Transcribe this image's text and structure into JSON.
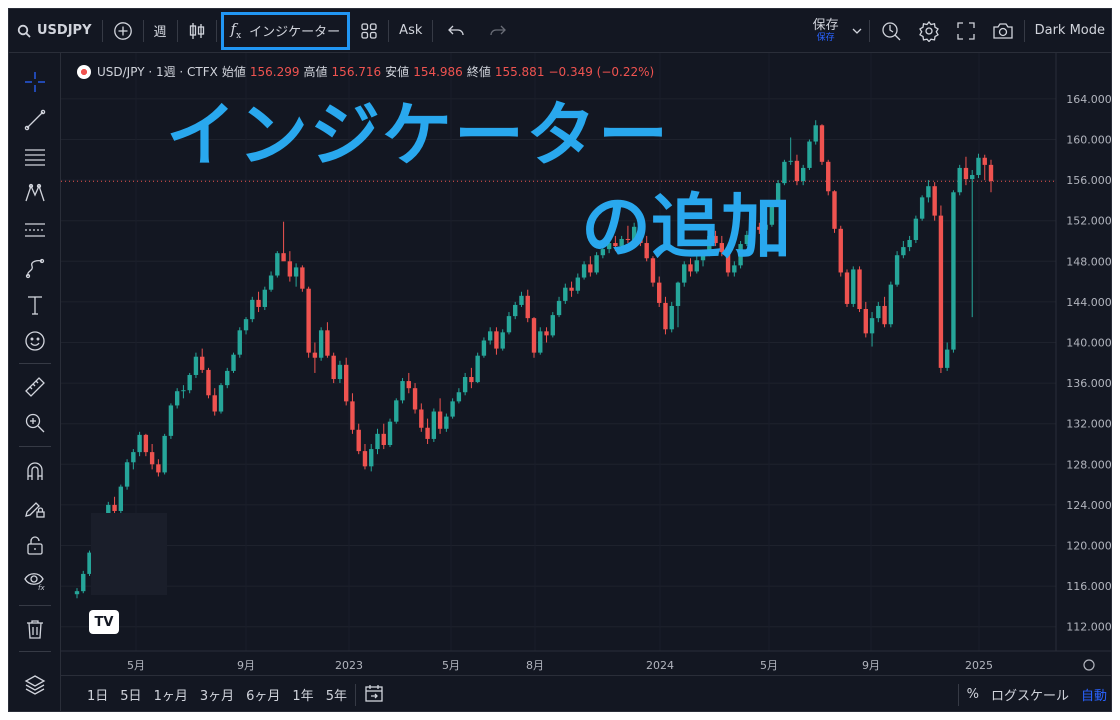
{
  "toolbar": {
    "symbol": "USDJPY",
    "interval": "週",
    "indicators_label": "インジケーター",
    "ask_label": "Ask",
    "save_label": "保存",
    "save_sub": "保存",
    "theme_label": "Dark Mode"
  },
  "legend": {
    "title": "USD/JPY · 1週 · CTFX",
    "open_label": "始値",
    "open": "156.299",
    "high_label": "高値",
    "high": "156.716",
    "low_label": "安値",
    "low": "154.986",
    "close_label": "終値",
    "close": "155.881",
    "change": "−0.349 (−0.22%)"
  },
  "overlay": {
    "line1": "インジケーター",
    "line2": "の追加"
  },
  "logo_text": "TV",
  "price_axis": [
    "164.000",
    "160.000",
    "156.000",
    "152.000",
    "148.000",
    "144.000",
    "140.000",
    "136.000",
    "132.000",
    "128.000",
    "124.000",
    "120.000",
    "116.000",
    "112.000"
  ],
  "time_axis": [
    "5月",
    "9月",
    "2023",
    "5月",
    "8月",
    "2024",
    "5月",
    "9月",
    "2025"
  ],
  "ranges": [
    "1日",
    "5日",
    "1ヶ月",
    "3ヶ月",
    "6ヶ月",
    "1年",
    "5年"
  ],
  "bottom_right": {
    "percent": "%",
    "log": "ログスケール",
    "auto": "自動"
  },
  "colors": {
    "up": "#26a69a",
    "down": "#ef5350",
    "accent": "#2196f3",
    "overlay": "#29a8ee",
    "background": "#131722"
  },
  "left_tools": [
    "crosshair-icon",
    "trendline-icon",
    "fib-icon",
    "pattern-icon",
    "measure-icon",
    "brush-icon",
    "text-icon",
    "emoji-icon",
    "ruler-icon",
    "zoom-icon",
    "magnet-icon",
    "lock-drawing-icon",
    "unlock-icon",
    "hide-icon",
    "trash-icon",
    "layers-icon"
  ],
  "chart_data": {
    "type": "candlestick",
    "last_price": 155.881,
    "ylim": [
      110,
      166
    ],
    "candles": [
      [
        115.2,
        115.8,
        114.8,
        115.5
      ],
      [
        115.5,
        117.5,
        115.3,
        117.2
      ],
      [
        117.2,
        119.5,
        117.0,
        119.3
      ],
      [
        119.3,
        121.0,
        119.0,
        120.8
      ],
      [
        120.8,
        122.5,
        120.5,
        122.3
      ],
      [
        122.3,
        124.3,
        122.0,
        124.0
      ],
      [
        124.0,
        124.8,
        122.8,
        123.4
      ],
      [
        123.4,
        126.0,
        123.2,
        125.8
      ],
      [
        125.8,
        128.5,
        125.5,
        128.2
      ],
      [
        128.2,
        129.5,
        127.5,
        129.2
      ],
      [
        129.2,
        131.2,
        128.8,
        130.9
      ],
      [
        130.9,
        131.0,
        128.8,
        129.2
      ],
      [
        129.2,
        130.0,
        127.5,
        128.0
      ],
      [
        128.0,
        128.5,
        126.8,
        127.2
      ],
      [
        127.2,
        131.0,
        127.0,
        130.8
      ],
      [
        130.8,
        134.0,
        130.5,
        133.8
      ],
      [
        133.8,
        135.5,
        133.5,
        135.2
      ],
      [
        135.2,
        135.8,
        134.5,
        135.3
      ],
      [
        135.3,
        137.0,
        135.0,
        136.8
      ],
      [
        136.8,
        139.0,
        136.5,
        138.6
      ],
      [
        138.6,
        139.4,
        137.0,
        137.3
      ],
      [
        137.3,
        137.5,
        134.5,
        134.8
      ],
      [
        134.8,
        135.5,
        132.8,
        133.2
      ],
      [
        133.2,
        136.0,
        133.0,
        135.8
      ],
      [
        135.8,
        137.5,
        135.5,
        137.2
      ],
      [
        137.2,
        139.0,
        137.0,
        138.8
      ],
      [
        138.8,
        141.5,
        138.5,
        141.2
      ],
      [
        141.2,
        142.5,
        140.8,
        142.3
      ],
      [
        142.3,
        144.5,
        142.0,
        144.2
      ],
      [
        144.2,
        145.0,
        143.0,
        143.5
      ],
      [
        143.5,
        145.5,
        143.2,
        145.2
      ],
      [
        145.2,
        147.0,
        145.0,
        146.6
      ],
      [
        146.6,
        149.0,
        146.4,
        148.8
      ],
      [
        148.8,
        151.9,
        148.5,
        148.0
      ],
      [
        148.0,
        149.0,
        146.0,
        146.5
      ],
      [
        146.5,
        147.8,
        145.5,
        147.4
      ],
      [
        147.4,
        147.6,
        145.0,
        145.3
      ],
      [
        145.3,
        145.5,
        138.5,
        139.0
      ],
      [
        139.0,
        140.0,
        137.0,
        138.5
      ],
      [
        138.5,
        141.5,
        138.2,
        141.2
      ],
      [
        141.2,
        142.0,
        138.5,
        138.7
      ],
      [
        138.7,
        139.0,
        136.0,
        136.4
      ],
      [
        136.4,
        138.2,
        136.0,
        137.8
      ],
      [
        137.8,
        138.5,
        133.8,
        134.2
      ],
      [
        134.2,
        135.0,
        131.0,
        131.4
      ],
      [
        131.4,
        132.0,
        129.0,
        129.3
      ],
      [
        129.3,
        130.0,
        127.5,
        127.8
      ],
      [
        127.8,
        130.0,
        127.3,
        129.5
      ],
      [
        129.5,
        131.5,
        129.0,
        131.0
      ],
      [
        131.0,
        132.0,
        129.5,
        129.9
      ],
      [
        129.9,
        132.5,
        129.7,
        132.2
      ],
      [
        132.2,
        134.5,
        132.0,
        134.3
      ],
      [
        134.3,
        136.5,
        134.0,
        136.2
      ],
      [
        136.2,
        137.0,
        135.0,
        135.5
      ],
      [
        135.5,
        136.0,
        133.0,
        133.4
      ],
      [
        133.4,
        134.0,
        131.2,
        131.6
      ],
      [
        131.6,
        132.5,
        130.0,
        130.5
      ],
      [
        130.5,
        133.5,
        130.2,
        133.2
      ],
      [
        133.2,
        134.5,
        131.0,
        131.5
      ],
      [
        131.5,
        133.0,
        131.2,
        132.7
      ],
      [
        132.7,
        134.5,
        132.5,
        134.2
      ],
      [
        134.2,
        135.5,
        134.0,
        135.1
      ],
      [
        135.1,
        137.0,
        134.8,
        136.6
      ],
      [
        136.6,
        137.5,
        135.5,
        136.1
      ],
      [
        136.1,
        139.0,
        136.0,
        138.7
      ],
      [
        138.7,
        140.5,
        138.5,
        140.2
      ],
      [
        140.2,
        141.5,
        139.8,
        141.1
      ],
      [
        141.1,
        141.5,
        138.8,
        139.4
      ],
      [
        139.4,
        141.3,
        139.2,
        141.0
      ],
      [
        141.0,
        143.0,
        140.8,
        142.6
      ],
      [
        142.6,
        144.0,
        142.3,
        143.7
      ],
      [
        143.7,
        145.0,
        143.5,
        144.6
      ],
      [
        144.6,
        145.2,
        142.0,
        142.4
      ],
      [
        142.4,
        142.5,
        138.5,
        139.0
      ],
      [
        139.0,
        141.5,
        138.8,
        141.1
      ],
      [
        141.1,
        141.5,
        140.0,
        140.7
      ],
      [
        140.7,
        143.0,
        140.5,
        142.7
      ],
      [
        142.7,
        144.5,
        142.5,
        144.1
      ],
      [
        144.1,
        145.8,
        143.8,
        145.4
      ],
      [
        145.4,
        146.0,
        144.5,
        145.1
      ],
      [
        145.1,
        146.8,
        144.8,
        146.4
      ],
      [
        146.4,
        148.0,
        146.2,
        147.7
      ],
      [
        147.7,
        148.5,
        146.5,
        146.9
      ],
      [
        146.9,
        148.9,
        146.7,
        148.6
      ],
      [
        148.6,
        149.5,
        148.3,
        149.2
      ],
      [
        149.2,
        150.2,
        148.8,
        149.8
      ],
      [
        149.8,
        150.5,
        149.0,
        149.5
      ],
      [
        149.5,
        150.5,
        149.3,
        150.2
      ],
      [
        150.2,
        151.5,
        149.8,
        150.1
      ],
      [
        150.1,
        151.8,
        149.8,
        151.4
      ],
      [
        151.4,
        151.6,
        149.5,
        149.8
      ],
      [
        149.8,
        150.5,
        148.0,
        148.3
      ],
      [
        148.3,
        148.5,
        145.5,
        145.9
      ],
      [
        145.9,
        146.5,
        143.5,
        143.9
      ],
      [
        143.9,
        144.5,
        140.8,
        141.3
      ],
      [
        141.3,
        144.0,
        141.0,
        143.6
      ],
      [
        143.6,
        146.0,
        141.5,
        145.9
      ],
      [
        145.9,
        148.0,
        145.5,
        147.7
      ],
      [
        147.7,
        148.3,
        146.5,
        147.0
      ],
      [
        147.0,
        148.5,
        146.8,
        148.1
      ],
      [
        148.1,
        149.0,
        147.5,
        148.7
      ],
      [
        148.7,
        150.8,
        148.5,
        150.5
      ],
      [
        150.5,
        151.0,
        149.5,
        149.8
      ],
      [
        149.8,
        150.5,
        148.5,
        148.9
      ],
      [
        148.9,
        149.5,
        146.5,
        146.9
      ],
      [
        146.9,
        148.0,
        146.5,
        147.6
      ],
      [
        147.6,
        150.0,
        147.3,
        149.7
      ],
      [
        149.7,
        151.0,
        149.5,
        150.6
      ],
      [
        150.6,
        151.9,
        150.3,
        151.4
      ],
      [
        151.4,
        151.8,
        150.7,
        151.1
      ],
      [
        151.1,
        152.0,
        150.8,
        151.6
      ],
      [
        151.6,
        154.0,
        151.4,
        153.8
      ],
      [
        153.8,
        156.0,
        153.5,
        155.7
      ],
      [
        155.7,
        158.0,
        155.5,
        157.8
      ],
      [
        157.8,
        160.2,
        157.5,
        157.9
      ],
      [
        157.9,
        158.5,
        155.5,
        155.9
      ],
      [
        155.9,
        157.5,
        155.5,
        157.2
      ],
      [
        157.2,
        160.0,
        157.0,
        159.8
      ],
      [
        159.8,
        161.9,
        159.5,
        161.4
      ],
      [
        161.4,
        161.5,
        157.5,
        157.8
      ],
      [
        157.8,
        158.0,
        154.5,
        154.9
      ],
      [
        154.9,
        155.0,
        150.8,
        151.2
      ],
      [
        151.2,
        151.5,
        146.5,
        146.9
      ],
      [
        146.9,
        147.2,
        143.5,
        143.8
      ],
      [
        143.8,
        147.5,
        143.5,
        147.2
      ],
      [
        147.2,
        147.5,
        143.0,
        143.3
      ],
      [
        143.3,
        144.0,
        140.5,
        140.9
      ],
      [
        140.9,
        143.0,
        139.6,
        142.4
      ],
      [
        142.4,
        144.0,
        142.0,
        143.6
      ],
      [
        143.6,
        144.5,
        141.5,
        141.8
      ],
      [
        141.8,
        146.0,
        141.5,
        145.7
      ],
      [
        145.7,
        149.0,
        145.5,
        148.6
      ],
      [
        148.6,
        150.0,
        148.3,
        149.4
      ],
      [
        149.4,
        150.5,
        149.0,
        150.1
      ],
      [
        150.1,
        152.5,
        149.8,
        152.2
      ],
      [
        152.2,
        154.5,
        152.0,
        154.3
      ],
      [
        154.3,
        156.0,
        153.8,
        155.4
      ],
      [
        155.4,
        155.8,
        152.0,
        152.5
      ],
      [
        152.5,
        153.5,
        137.0,
        137.5
      ],
      [
        137.5,
        140.0,
        137.2,
        139.3
      ],
      [
        139.3,
        155.0,
        139.0,
        154.8
      ],
      [
        154.8,
        157.5,
        154.5,
        157.2
      ],
      [
        157.2,
        158.3,
        155.5,
        156.1
      ],
      [
        156.1,
        157.0,
        142.5,
        156.5
      ],
      [
        156.5,
        158.6,
        156.2,
        158.2
      ],
      [
        158.2,
        158.5,
        156.0,
        157.5
      ],
      [
        157.5,
        158.0,
        154.8,
        155.9
      ]
    ]
  }
}
